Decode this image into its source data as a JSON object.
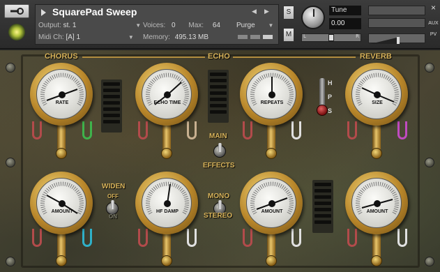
{
  "instrument": {
    "name": "SquarePad Sweep",
    "output_label": "Output:",
    "output_value": "st. 1",
    "voices_label": "Voices:",
    "voices_value": "0",
    "max_label": "Max:",
    "max_value": "64",
    "purge_label": "Purge",
    "midi_label": "Midi Ch:",
    "midi_value": "[A] 1",
    "memory_label": "Memory:",
    "memory_value": "495.13 MB"
  },
  "controls": {
    "solo": "S",
    "mute": "M",
    "tune_label": "Tune",
    "tune_value": "0.00",
    "pan_left": "L",
    "pan_right": "R",
    "close": "×",
    "aux": "AUX",
    "pv": "PV"
  },
  "sections": {
    "chorus": "CHORUS",
    "echo": "ECHO",
    "reverb": "REVERB"
  },
  "gauges": {
    "rate": "RATE",
    "echo_time": "ECHO TIME",
    "repeats": "REPEATS",
    "size": "SIZE",
    "chorus_amount": "AMOUNT",
    "hf_damp": "HF DAMP",
    "echo_amount": "AMOUNT",
    "reverb_amount": "AMOUNT"
  },
  "switches": {
    "main": "MAIN",
    "effects": "EFFECTS",
    "widen": "WIDEN",
    "widen_off": "OFF",
    "widen_on": "ON",
    "mono": "MONO",
    "stereo": "STEREO",
    "hps_h": "H",
    "hps_p": "P",
    "hps_s": "S"
  },
  "wire_colors": {
    "red": "#b24b4b",
    "green": "#3fb24b",
    "white": "#e0e0e0",
    "magenta": "#c04bc0",
    "cyan": "#2fb0c8",
    "tan": "#c8b090"
  },
  "icons": [
    "wrench-icon",
    "logo-icon",
    "prev-arrow-icon",
    "next-arrow-icon",
    "close-icon"
  ]
}
